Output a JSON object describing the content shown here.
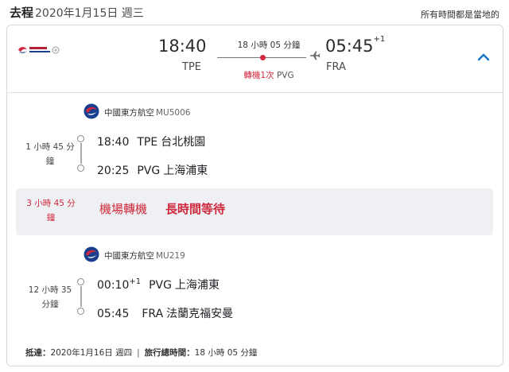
{
  "header": {
    "direction": "去程",
    "date": "2020年1月15日 週三",
    "note": "所有時間都是當地的"
  },
  "summary": {
    "airline_logo_text": "CHINA EASTERN",
    "depart_time": "18:40",
    "depart_airport": "TPE",
    "duration": "18 小時 05 分鐘",
    "arrive_time": "05:45",
    "arrive_day_offset": "+1",
    "arrive_airport": "FRA",
    "stops_label": "轉機1次",
    "stop_airport": "PVG"
  },
  "segments": [
    {
      "airline": "中國東方航空",
      "flight_no": "MU5006",
      "duration": "1 小時 45 分鐘",
      "from": {
        "time": "18:40",
        "code": "TPE",
        "city": "台北桃園"
      },
      "to": {
        "time": "20:25",
        "code": "PVG",
        "city": "上海浦東"
      }
    },
    {
      "airline": "中國東方航空",
      "flight_no": "MU219",
      "duration": "12 小時 35 分鐘",
      "from": {
        "time": "00:10",
        "day_offset": "+1",
        "code": "PVG",
        "city": "上海浦東"
      },
      "to": {
        "time": "05:45",
        "code": "FRA",
        "city": "法蘭克福安曼"
      }
    }
  ],
  "layover": {
    "duration": "3 小時 45 分鐘",
    "label": "機場轉機",
    "warning": "長時間等待"
  },
  "footer": {
    "arrive_label": "抵達：",
    "arrive_date": "2020年1月16日 週四",
    "total_label": "旅行總時間：",
    "total_duration": "18 小時 05 分鐘"
  },
  "colors": {
    "accent_red": "#d0283c",
    "accent_blue": "#1a73c9",
    "layover_bg": "#eef0f3"
  },
  "icons": {
    "expand": "chevron-up-icon",
    "plane": "airplane-icon",
    "airline": "china-eastern-logo-icon"
  }
}
